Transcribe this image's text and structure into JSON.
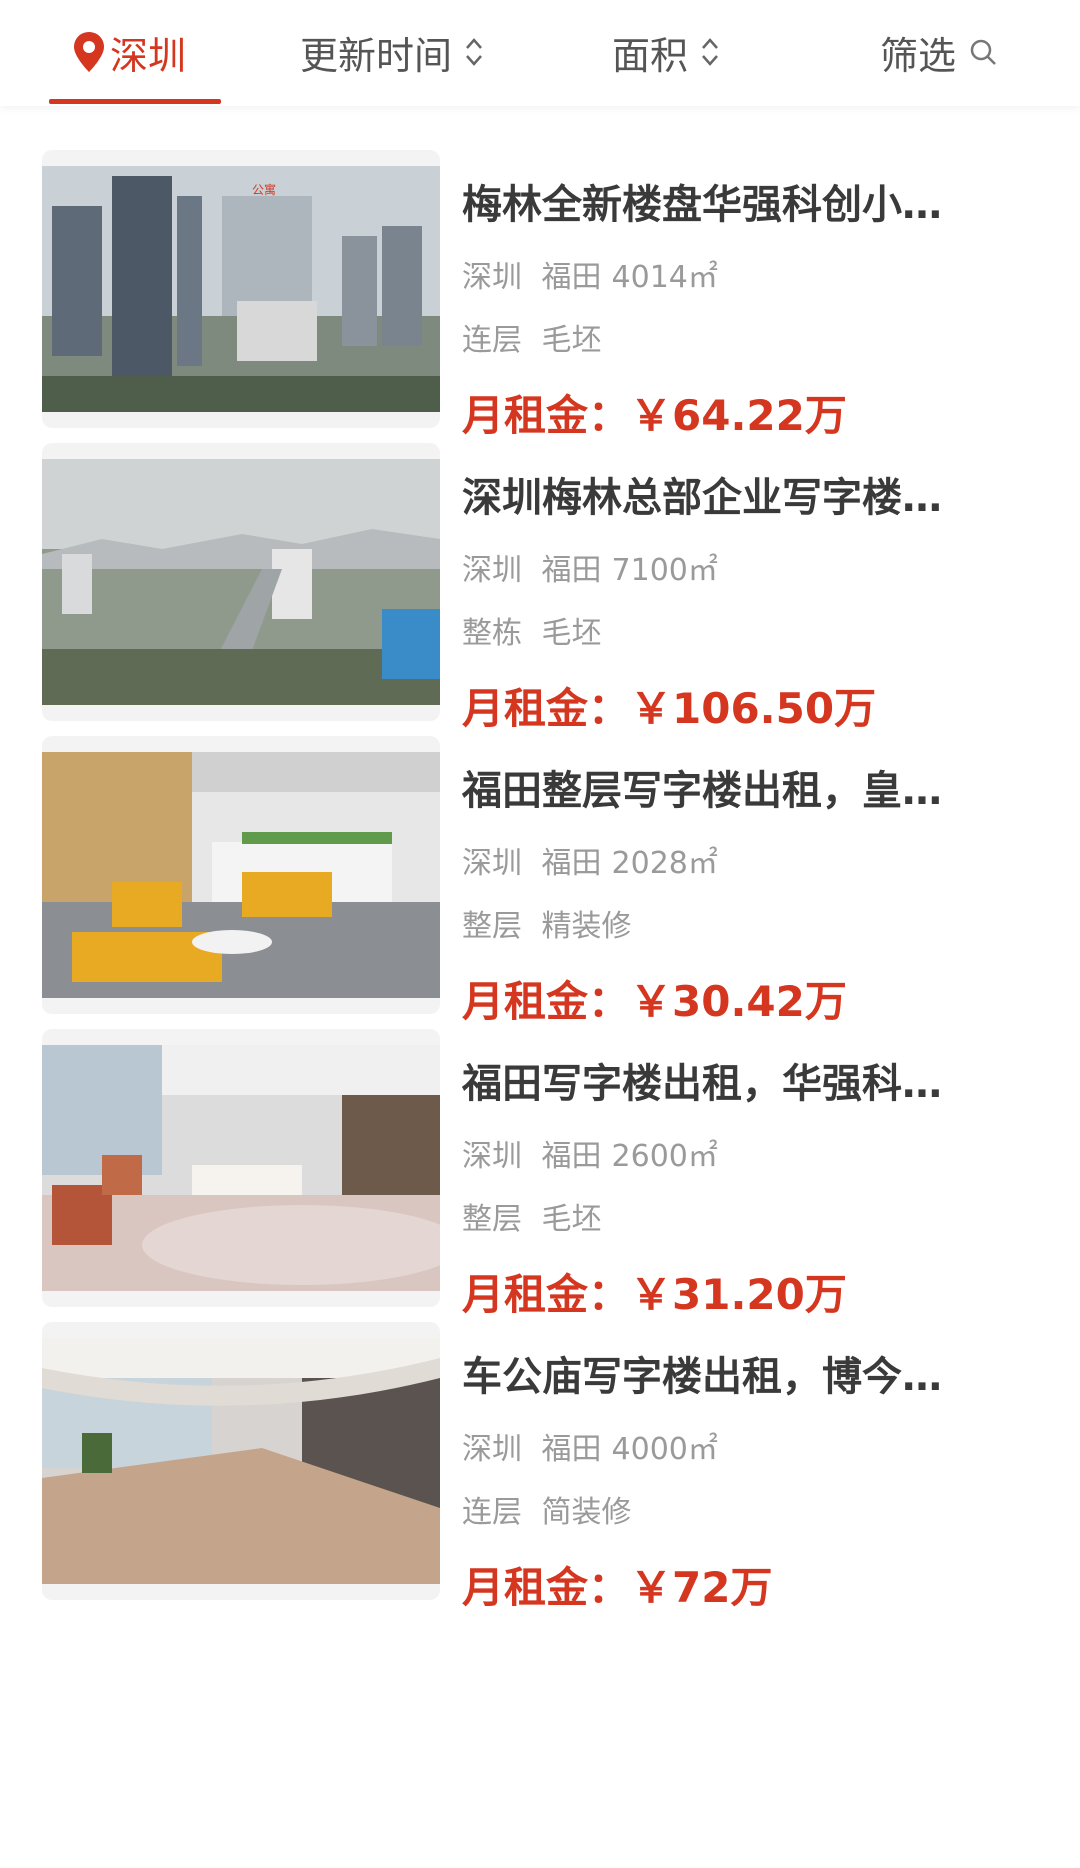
{
  "tabs": [
    {
      "label": "深圳",
      "icon": "location-pin-icon",
      "active": true
    },
    {
      "label": "更新时间",
      "icon": "sort-caret-icon"
    },
    {
      "label": "面积",
      "icon": "sort-caret-icon"
    },
    {
      "label": "筛选",
      "icon": "search-icon"
    }
  ],
  "colors": {
    "accent": "#d4361f",
    "text": "#3a3a3a",
    "muted": "#9a9a9a"
  },
  "listings": [
    {
      "title": "梅林全新楼盘华强科创小…",
      "city": "深圳",
      "district": "福田",
      "area": "4014㎡",
      "layout": "连层",
      "finish": "毛坯",
      "price_label": "月租金：",
      "price": "￥64.22万",
      "photo_text": [
        "公寓"
      ]
    },
    {
      "title": "深圳梅林总部企业写字楼…",
      "city": "深圳",
      "district": "福田",
      "area": "7100㎡",
      "layout": "整栋",
      "finish": "毛坯",
      "price_label": "月租金：",
      "price": "￥106.50万"
    },
    {
      "title": "福田整层写字楼出租，皇…",
      "city": "深圳",
      "district": "福田",
      "area": "2028㎡",
      "layout": "整层",
      "finish": "精装修",
      "price_label": "月租金：",
      "price": "￥30.42万"
    },
    {
      "title": "福田写字楼出租，华强科…",
      "city": "深圳",
      "district": "福田",
      "area": "2600㎡",
      "layout": "整层",
      "finish": "毛坯",
      "price_label": "月租金：",
      "price": "￥31.20万"
    },
    {
      "title": "车公庙写字楼出租，博今…",
      "city": "深圳",
      "district": "福田",
      "area": "4000㎡",
      "layout": "连层",
      "finish": "简装修",
      "price_label": "月租金：",
      "price": "￥72万"
    }
  ]
}
